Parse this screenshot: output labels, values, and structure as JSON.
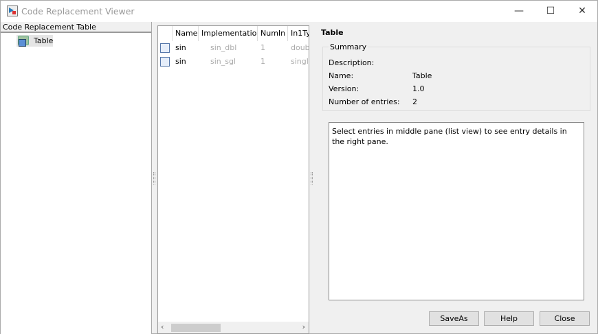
{
  "window": {
    "title": "Code Replacement Viewer",
    "minimize": "—",
    "maximize": "☐",
    "close": "✕"
  },
  "left_pane": {
    "header": "Code Replacement Table",
    "tree": [
      {
        "label": "Table",
        "icon": "table-folder-icon"
      }
    ]
  },
  "middle_pane": {
    "columns": [
      "Name",
      "Implementation",
      "NumIn",
      "In1Ty"
    ],
    "rows": [
      {
        "name": "sin",
        "implementation": "sin_dbl",
        "numin": "1",
        "in1type": "doubl"
      },
      {
        "name": "sin",
        "implementation": "sin_sgl",
        "numin": "1",
        "in1type": "single"
      }
    ],
    "scroll_left": "‹",
    "scroll_right": "›"
  },
  "right_pane": {
    "title": "Table",
    "summary_label": "Summary",
    "fields": [
      {
        "key": "Description:",
        "value": ""
      },
      {
        "key": "Name:",
        "value": "Table"
      },
      {
        "key": "Version:",
        "value": "1.0"
      },
      {
        "key": "Number of entries:",
        "value": "2"
      }
    ],
    "detail_text": "Select entries in middle pane (list view) to see entry details in the right pane."
  },
  "buttons": {
    "saveas": "SaveAs",
    "help": "Help",
    "close": "Close"
  }
}
